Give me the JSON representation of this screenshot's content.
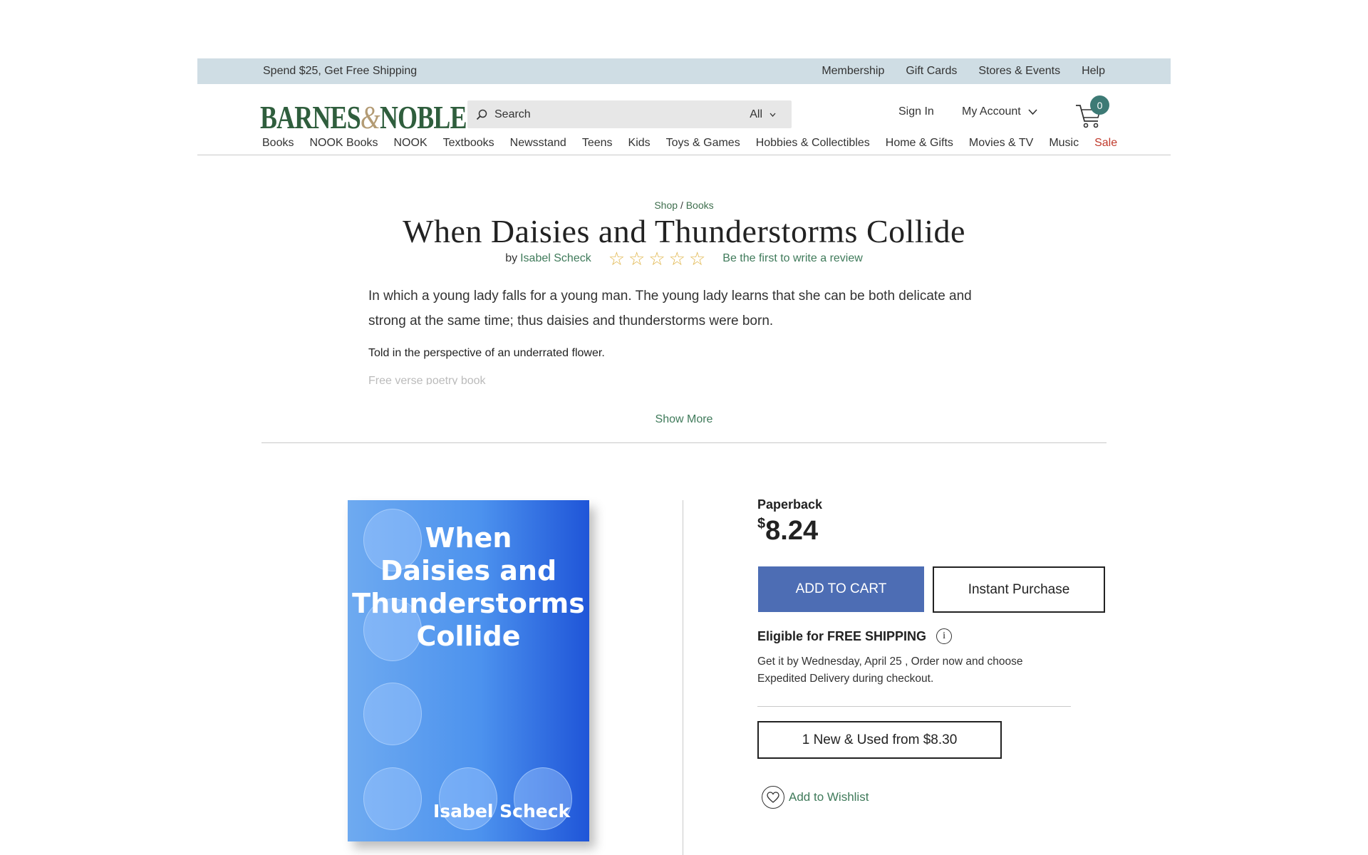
{
  "promo": {
    "text": "Spend $25, Get Free Shipping",
    "links": [
      "Membership",
      "Gift Cards",
      "Stores & Events",
      "Help"
    ]
  },
  "header": {
    "logo_left": "BARNES",
    "logo_amp": "&",
    "logo_right": "NOBLE",
    "search_placeholder": "Search",
    "search_category": "All",
    "sign_in": "Sign In",
    "my_account": "My Account",
    "cart_count": "0"
  },
  "nav": [
    "Books",
    "NOOK Books",
    "NOOK",
    "Textbooks",
    "Newsstand",
    "Teens",
    "Kids",
    "Toys & Games",
    "Hobbies & Collectibles",
    "Home & Gifts",
    "Movies & TV",
    "Music",
    "Sale"
  ],
  "breadcrumb": {
    "shop": "Shop",
    "separator": "/",
    "books": "Books"
  },
  "product": {
    "title": "When Daisies and Thunderstorms Collide",
    "by": "by",
    "author": "Isabel Scheck",
    "rating_stars": 0,
    "review_link": "Be the first to write a review",
    "description": "In which a young lady falls for a young man. The young lady learns that she can be both delicate and strong at the same time; thus daisies and thunderstorms were born.",
    "description_2": "Told in the perspective of an underrated flower.",
    "description_3": "Free verse poetry book",
    "show_more": "Show More"
  },
  "cover": {
    "title_lines": [
      "When",
      "Daisies and",
      "Thunderstorms",
      "Collide"
    ],
    "author": "Isabel Scheck"
  },
  "purchase": {
    "format": "Paperback",
    "currency": "$",
    "price": "8.24",
    "add_to_cart": "ADD TO CART",
    "instant_purchase": "Instant Purchase",
    "shipping": "Eligible for FREE SHIPPING",
    "delivery": "Get it by Wednesday, April 25 , Order now and choose Expedited Delivery during checkout.",
    "new_used": "1 New & Used from $8.30",
    "wishlist": "Add to Wishlist"
  },
  "colors": {
    "brand_green": "#2f5e3d",
    "link_green": "#3f7a5a",
    "cart_button": "#4d6db4",
    "sale_red": "#c0392b",
    "star_gold": "#e0b54a"
  }
}
